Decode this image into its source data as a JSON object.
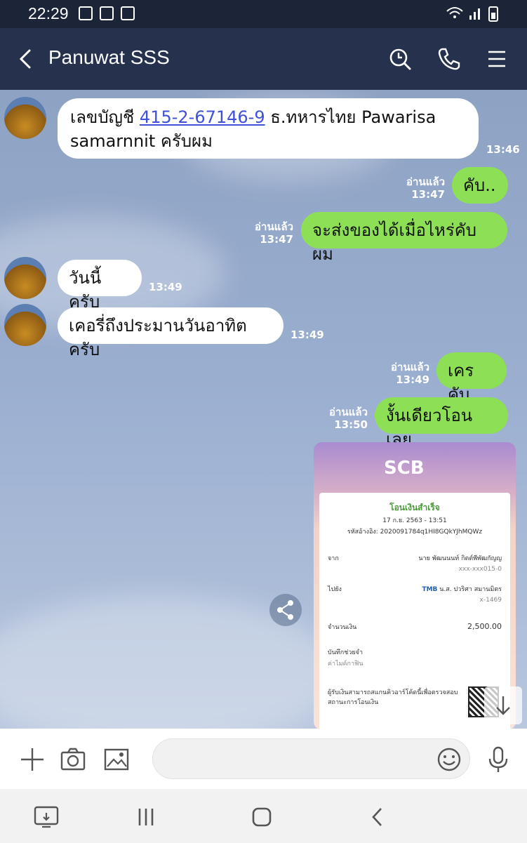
{
  "status": {
    "time": "22:29"
  },
  "header": {
    "title": "Panuwat SSS"
  },
  "messages": [
    {
      "dir": "in",
      "text_before": "เลขบัญชี ",
      "link": "415-2-67146-9",
      "text_after": " ธ.ทหารไทย Pawarisa samarnnit ครับผม",
      "time": "13:46"
    },
    {
      "dir": "out",
      "text": "คับ..",
      "read": "อ่านแล้ว",
      "time": "13:47"
    },
    {
      "dir": "out",
      "text": "จะส่งของได้เมื่อไหร่คับผม",
      "read": "อ่านแล้ว",
      "time": "13:47"
    },
    {
      "dir": "in",
      "text": "วันนี้ครับ",
      "time": "13:49"
    },
    {
      "dir": "in",
      "text": "เคอรี่ถึงประมานวันอาทิตครับ",
      "time": "13:49"
    },
    {
      "dir": "out",
      "text": "เครคับ",
      "read": "อ่านแล้ว",
      "time": "13:49"
    },
    {
      "dir": "out",
      "text": "งั้นเดียวโอนเลย",
      "read": "อ่านแล้ว",
      "time": "13:50"
    }
  ],
  "receipt": {
    "bank": "SCB",
    "status": "โอนเงินสำเร็จ",
    "datetime": "17 ก.ย. 2563 - 13:51",
    "ref": "รหัสอ้างอิง: 2020091784q1HI8GQkYJhMQWz",
    "from_label": "จาก",
    "from_name": "นาย พัฒนนนท์ กิตต์พีพัฒกัญญ",
    "from_account": "xxx-xxx015-0",
    "to_label": "ไปยัง",
    "to_bank": "TMB",
    "to_name": "น.ส. ปวริศา สมานมิตร",
    "to_account": "x-1469",
    "amount_label": "จำนวนเงิน",
    "amount": "2,500.00",
    "note_label": "บันทึกช่วยจำ",
    "note_value": "ค่าไมค์กาฟิน",
    "qr_text": "ผู้รับเงินสามารถสแกนคิวอาร์โค้ดนี้เพื่อตรวจสอบสถานะการโอนเงิน"
  },
  "input": {
    "placeholder": "",
    "value": ""
  },
  "icons": {
    "back": "back-arrow-icon",
    "search": "search-icon",
    "call": "phone-icon",
    "menu": "hamburger-icon",
    "plus": "plus-icon",
    "camera": "camera-icon",
    "image": "image-icon",
    "emoji": "emoji-icon",
    "mic": "microphone-icon"
  },
  "colors": {
    "header": "#25314d",
    "out_bubble": "#8de055",
    "in_bubble": "#ffffff",
    "link": "#3f51d6"
  }
}
